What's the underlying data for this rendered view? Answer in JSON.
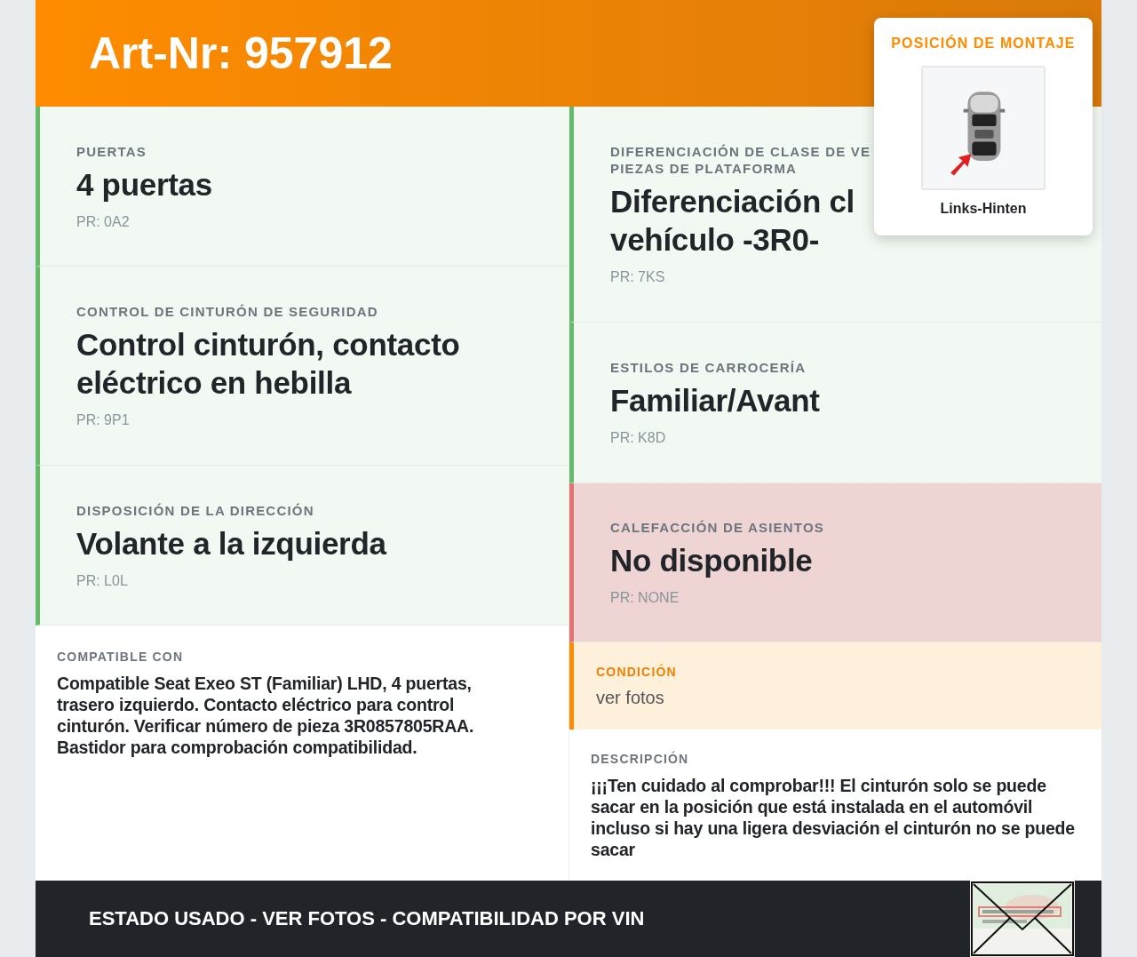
{
  "header": {
    "title": "Art-Nr: 957912"
  },
  "mounting": {
    "title": "POSICIÓN DE MONTAJE",
    "caption": "Links-Hinten"
  },
  "left_cards": [
    {
      "label": "PUERTAS",
      "value": "4 puertas",
      "pr": "PR: 0A2",
      "color": "#66bb6a"
    },
    {
      "label": "CONTROL DE CINTURÓN DE SEGURIDAD",
      "value": "Control cinturón, contacto eléctrico en hebilla",
      "pr": "PR: 9P1",
      "color": "#66bb6a"
    },
    {
      "label": "DISPOSICIÓN DE LA DIRECCIÓN",
      "value": "Volante a la izquierda",
      "pr": "PR: L0L",
      "color": "#66bb6a"
    }
  ],
  "compatible": {
    "label": "COMPATIBLE CON",
    "text": "Compatible Seat Exeo ST (Familiar) LHD, 4 puertas, trasero izquierdo. Contacto eléctrico para control cinturón. Verificar número de pieza 3R0857805RAA. Bastidor para comprobación compatibilidad."
  },
  "right_cards": [
    {
      "label": "DIFERENCIACIÓN DE CLASE DE VE\nPIEZAS DE PLATAFORMA",
      "value": "Diferenciación cl\nvehículo -3R0-",
      "pr": "PR: 7KS",
      "color": "#66bb6a"
    },
    {
      "label": "ESTILOS DE CARROCERÍA",
      "value": "Familiar/Avant",
      "pr": "PR: K8D",
      "color": "#66bb6a"
    },
    {
      "label": "CALEFACCIÓN DE ASIENTOS",
      "value": "No disponible",
      "pr": "PR: NONE",
      "color": "#e57373"
    }
  ],
  "condition": {
    "label": "CONDICIÓN",
    "value": "ver fotos"
  },
  "description": {
    "label": "DESCRIPCIÓN",
    "text": "¡¡¡Ten cuidado al comprobar!!! El cinturón solo se puede sacar en la posición que está instalada en el automóvil incluso si hay una ligera desviación el cinturón no se puede sacar"
  },
  "footer": {
    "text": "ESTADO USADO - VER FOTOS - COMPATIBILIDAD POR VIN"
  }
}
